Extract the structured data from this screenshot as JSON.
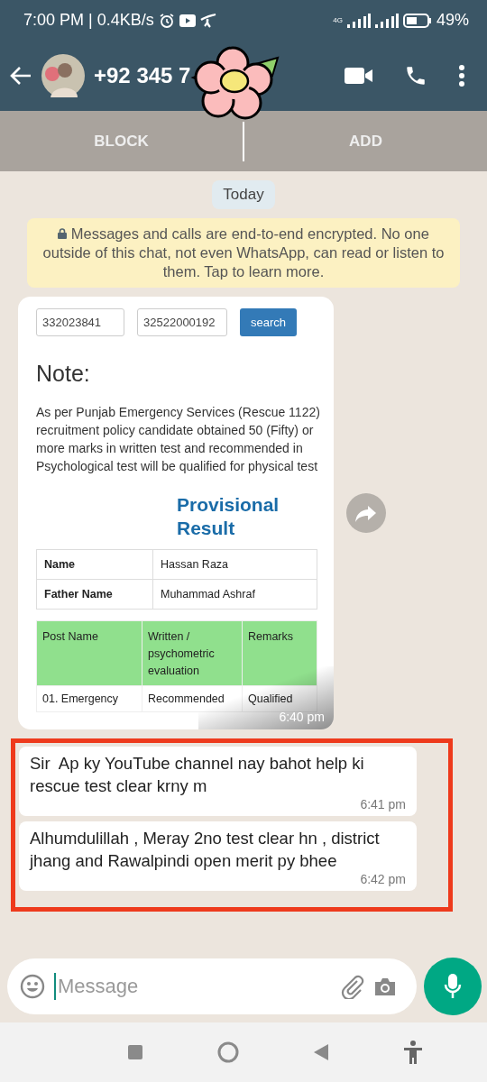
{
  "status_bar": {
    "time": "7:00 PM | 0.4KB/s",
    "network": "4G",
    "battery": "49%"
  },
  "header": {
    "contact": "+92 345 7"
  },
  "action_bar": [
    {
      "label": "BLOCK"
    },
    {
      "label": "ADD"
    }
  ],
  "date_chip": "Today",
  "encryption_notice": "Messages and calls are end-to-end encrypted. No one outside of this chat, not even WhatsApp, can read or listen to them. Tap to learn more.",
  "messages": [
    {
      "kind": "image",
      "time": "6:40 pm",
      "screenshot": {
        "fields": [
          "332023841",
          "32522000192"
        ],
        "search_button": "search",
        "note_title": "Note:",
        "note_text": "As per Punjab Emergency Services (Rescue 1122) recruitment policy candidate obtained 50 (Fifty) or more marks in written test and recommended in Psychological test will be qualified for physical test",
        "result_title": "Provisional Result",
        "info_rows": [
          {
            "label": "Name",
            "value": "Hassan Raza"
          },
          {
            "label": "Father Name",
            "value": "Muhammad Ashraf"
          }
        ],
        "result_columns": [
          "Post Name",
          "Written / psychometric evaluation",
          "Remarks"
        ],
        "result_row": [
          "01. Emergency",
          "Recommended",
          "Qualified"
        ]
      }
    }
  ],
  "highlighted_messages": [
    {
      "text": "Sir  Ap ky YouTube channel nay bahot help ki rescue test clear krny m",
      "time": "6:41 pm"
    },
    {
      "text": "Alhumdulillah , Meray 2no test clear hn , district jhang and Rawalpindi open merit py bhee",
      "time": "6:42 pm"
    }
  ],
  "composer": {
    "placeholder": "Message"
  }
}
